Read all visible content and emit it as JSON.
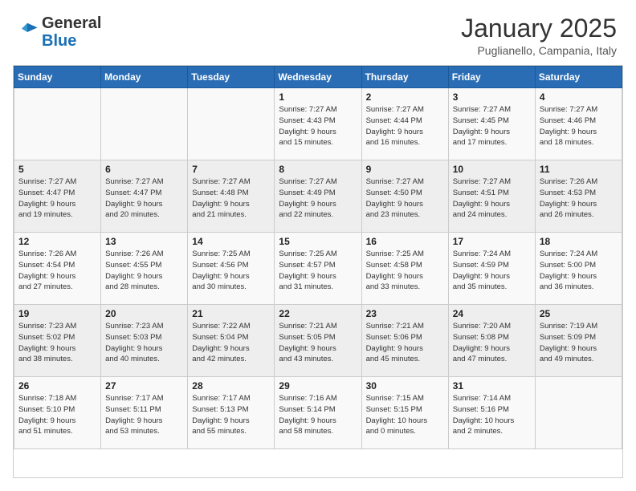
{
  "header": {
    "logo_general": "General",
    "logo_blue": "Blue",
    "title": "January 2025",
    "location": "Puglianello, Campania, Italy"
  },
  "calendar": {
    "days_of_week": [
      "Sunday",
      "Monday",
      "Tuesday",
      "Wednesday",
      "Thursday",
      "Friday",
      "Saturday"
    ],
    "weeks": [
      [
        {
          "day": "",
          "info": ""
        },
        {
          "day": "",
          "info": ""
        },
        {
          "day": "",
          "info": ""
        },
        {
          "day": "1",
          "info": "Sunrise: 7:27 AM\nSunset: 4:43 PM\nDaylight: 9 hours\nand 15 minutes."
        },
        {
          "day": "2",
          "info": "Sunrise: 7:27 AM\nSunset: 4:44 PM\nDaylight: 9 hours\nand 16 minutes."
        },
        {
          "day": "3",
          "info": "Sunrise: 7:27 AM\nSunset: 4:45 PM\nDaylight: 9 hours\nand 17 minutes."
        },
        {
          "day": "4",
          "info": "Sunrise: 7:27 AM\nSunset: 4:46 PM\nDaylight: 9 hours\nand 18 minutes."
        }
      ],
      [
        {
          "day": "5",
          "info": "Sunrise: 7:27 AM\nSunset: 4:47 PM\nDaylight: 9 hours\nand 19 minutes."
        },
        {
          "day": "6",
          "info": "Sunrise: 7:27 AM\nSunset: 4:47 PM\nDaylight: 9 hours\nand 20 minutes."
        },
        {
          "day": "7",
          "info": "Sunrise: 7:27 AM\nSunset: 4:48 PM\nDaylight: 9 hours\nand 21 minutes."
        },
        {
          "day": "8",
          "info": "Sunrise: 7:27 AM\nSunset: 4:49 PM\nDaylight: 9 hours\nand 22 minutes."
        },
        {
          "day": "9",
          "info": "Sunrise: 7:27 AM\nSunset: 4:50 PM\nDaylight: 9 hours\nand 23 minutes."
        },
        {
          "day": "10",
          "info": "Sunrise: 7:27 AM\nSunset: 4:51 PM\nDaylight: 9 hours\nand 24 minutes."
        },
        {
          "day": "11",
          "info": "Sunrise: 7:26 AM\nSunset: 4:53 PM\nDaylight: 9 hours\nand 26 minutes."
        }
      ],
      [
        {
          "day": "12",
          "info": "Sunrise: 7:26 AM\nSunset: 4:54 PM\nDaylight: 9 hours\nand 27 minutes."
        },
        {
          "day": "13",
          "info": "Sunrise: 7:26 AM\nSunset: 4:55 PM\nDaylight: 9 hours\nand 28 minutes."
        },
        {
          "day": "14",
          "info": "Sunrise: 7:25 AM\nSunset: 4:56 PM\nDaylight: 9 hours\nand 30 minutes."
        },
        {
          "day": "15",
          "info": "Sunrise: 7:25 AM\nSunset: 4:57 PM\nDaylight: 9 hours\nand 31 minutes."
        },
        {
          "day": "16",
          "info": "Sunrise: 7:25 AM\nSunset: 4:58 PM\nDaylight: 9 hours\nand 33 minutes."
        },
        {
          "day": "17",
          "info": "Sunrise: 7:24 AM\nSunset: 4:59 PM\nDaylight: 9 hours\nand 35 minutes."
        },
        {
          "day": "18",
          "info": "Sunrise: 7:24 AM\nSunset: 5:00 PM\nDaylight: 9 hours\nand 36 minutes."
        }
      ],
      [
        {
          "day": "19",
          "info": "Sunrise: 7:23 AM\nSunset: 5:02 PM\nDaylight: 9 hours\nand 38 minutes."
        },
        {
          "day": "20",
          "info": "Sunrise: 7:23 AM\nSunset: 5:03 PM\nDaylight: 9 hours\nand 40 minutes."
        },
        {
          "day": "21",
          "info": "Sunrise: 7:22 AM\nSunset: 5:04 PM\nDaylight: 9 hours\nand 42 minutes."
        },
        {
          "day": "22",
          "info": "Sunrise: 7:21 AM\nSunset: 5:05 PM\nDaylight: 9 hours\nand 43 minutes."
        },
        {
          "day": "23",
          "info": "Sunrise: 7:21 AM\nSunset: 5:06 PM\nDaylight: 9 hours\nand 45 minutes."
        },
        {
          "day": "24",
          "info": "Sunrise: 7:20 AM\nSunset: 5:08 PM\nDaylight: 9 hours\nand 47 minutes."
        },
        {
          "day": "25",
          "info": "Sunrise: 7:19 AM\nSunset: 5:09 PM\nDaylight: 9 hours\nand 49 minutes."
        }
      ],
      [
        {
          "day": "26",
          "info": "Sunrise: 7:18 AM\nSunset: 5:10 PM\nDaylight: 9 hours\nand 51 minutes."
        },
        {
          "day": "27",
          "info": "Sunrise: 7:17 AM\nSunset: 5:11 PM\nDaylight: 9 hours\nand 53 minutes."
        },
        {
          "day": "28",
          "info": "Sunrise: 7:17 AM\nSunset: 5:13 PM\nDaylight: 9 hours\nand 55 minutes."
        },
        {
          "day": "29",
          "info": "Sunrise: 7:16 AM\nSunset: 5:14 PM\nDaylight: 9 hours\nand 58 minutes."
        },
        {
          "day": "30",
          "info": "Sunrise: 7:15 AM\nSunset: 5:15 PM\nDaylight: 10 hours\nand 0 minutes."
        },
        {
          "day": "31",
          "info": "Sunrise: 7:14 AM\nSunset: 5:16 PM\nDaylight: 10 hours\nand 2 minutes."
        },
        {
          "day": "",
          "info": ""
        }
      ]
    ]
  }
}
